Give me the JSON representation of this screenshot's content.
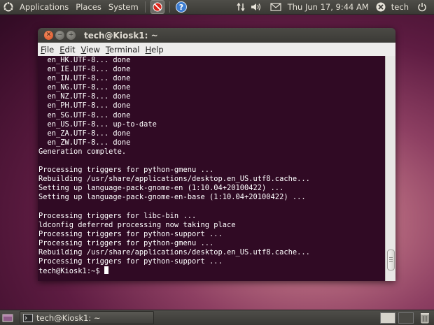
{
  "top_panel": {
    "menus": [
      "Applications",
      "Places",
      "System"
    ],
    "clock": "Thu Jun 17,  9:44 AM",
    "user": "tech",
    "icons": [
      "ubuntu-logo-icon",
      "no-entry-icon",
      "help-icon",
      "network-icon",
      "volume-icon",
      "mail-icon",
      "user-icon",
      "power-icon"
    ]
  },
  "window": {
    "title": "tech@Kiosk1: ~",
    "menu": [
      "File",
      "Edit",
      "View",
      "Terminal",
      "Help"
    ],
    "mnemonics": [
      "F",
      "E",
      "V",
      "T",
      "H"
    ]
  },
  "terminal": {
    "lines": [
      "  en_HK.UTF-8... done",
      "  en_IE.UTF-8... done",
      "  en_IN.UTF-8... done",
      "  en_NG.UTF-8... done",
      "  en_NZ.UTF-8... done",
      "  en_PH.UTF-8... done",
      "  en_SG.UTF-8... done",
      "  en_US.UTF-8... up-to-date",
      "  en_ZA.UTF-8... done",
      "  en_ZW.UTF-8... done",
      "Generation complete.",
      "",
      "Processing triggers for python-gmenu ...",
      "Rebuilding /usr/share/applications/desktop.en_US.utf8.cache...",
      "Setting up language-pack-gnome-en (1:10.04+20100422) ...",
      "Setting up language-pack-gnome-en-base (1:10.04+20100422) ...",
      "",
      "Processing triggers for libc-bin ...",
      "ldconfig deferred processing now taking place",
      "Processing triggers for python-support ...",
      "Processing triggers for python-gmenu ...",
      "Rebuilding /usr/share/applications/desktop.en_US.utf8.cache...",
      "Processing triggers for python-support ..."
    ],
    "prompt": "tech@Kiosk1:~$ ",
    "colors": {
      "background": "#300a24",
      "foreground": "#ffffff"
    }
  },
  "bottom_panel": {
    "task_label": "tech@Kiosk1: ~",
    "icons": [
      "show-desktop-icon",
      "terminal-icon",
      "trash-icon"
    ]
  }
}
